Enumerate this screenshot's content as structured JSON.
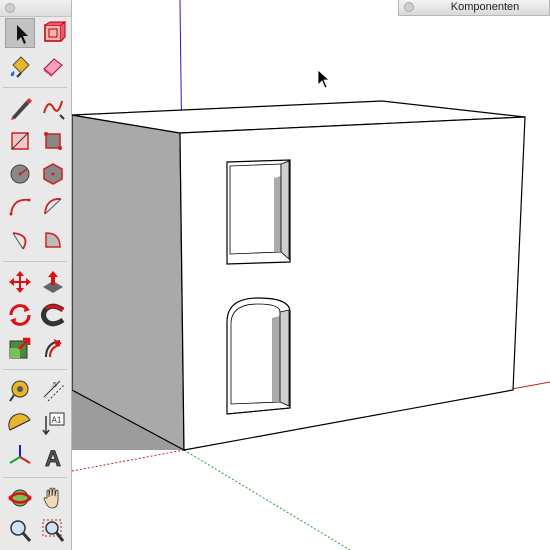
{
  "components_panel": {
    "title": "Komponenten"
  },
  "colors": {
    "x_axis": "#c81e1e",
    "y_axis": "#1f9e2a",
    "z_axis": "#1c1ccf",
    "wall_shaded": "#a9a9a9",
    "toolbar_bg": "#e9e9e9"
  },
  "toolbar": {
    "tools": [
      {
        "name": "select-tool",
        "icon": "arrow-icon",
        "active": true
      },
      {
        "name": "make-component-tool",
        "icon": "component-icon"
      },
      {
        "name": "paint-bucket-tool",
        "icon": "paint-bucket-icon"
      },
      {
        "name": "eraser-tool",
        "icon": "eraser-icon"
      },
      {
        "name": "line-tool",
        "icon": "pencil-icon"
      },
      {
        "name": "freehand-tool",
        "icon": "freehand-icon"
      },
      {
        "name": "rectangle-tool",
        "icon": "rectangle-icon"
      },
      {
        "name": "rotated-rectangle-tool",
        "icon": "rotated-rectangle-icon"
      },
      {
        "name": "circle-tool",
        "icon": "circle-icon"
      },
      {
        "name": "polygon-tool",
        "icon": "polygon-icon"
      },
      {
        "name": "arc-tool",
        "icon": "arc-icon"
      },
      {
        "name": "two-point-arc-tool",
        "icon": "two-point-arc-icon"
      },
      {
        "name": "three-point-arc-tool",
        "icon": "three-point-arc-icon"
      },
      {
        "name": "pie-tool",
        "icon": "pie-icon"
      },
      {
        "name": "move-tool",
        "icon": "move-icon"
      },
      {
        "name": "push-pull-tool",
        "icon": "push-pull-icon"
      },
      {
        "name": "rotate-tool",
        "icon": "rotate-icon"
      },
      {
        "name": "follow-me-tool",
        "icon": "follow-me-icon"
      },
      {
        "name": "scale-tool",
        "icon": "scale-icon"
      },
      {
        "name": "offset-tool",
        "icon": "offset-icon"
      },
      {
        "name": "tape-measure-tool",
        "icon": "tape-measure-icon"
      },
      {
        "name": "dimension-tool",
        "icon": "dimension-icon"
      },
      {
        "name": "protractor-tool",
        "icon": "protractor-icon"
      },
      {
        "name": "text-tool",
        "icon": "text-icon"
      },
      {
        "name": "axes-tool",
        "icon": "axes-icon"
      },
      {
        "name": "3d-text-tool",
        "icon": "3d-text-icon"
      },
      {
        "name": "orbit-tool",
        "icon": "orbit-icon"
      },
      {
        "name": "pan-tool",
        "icon": "hand-icon"
      },
      {
        "name": "zoom-tool",
        "icon": "zoom-icon"
      },
      {
        "name": "zoom-window-tool",
        "icon": "zoom-window-icon"
      }
    ],
    "text_tool_glyph": "A1",
    "threed_text_glyph": "A"
  }
}
